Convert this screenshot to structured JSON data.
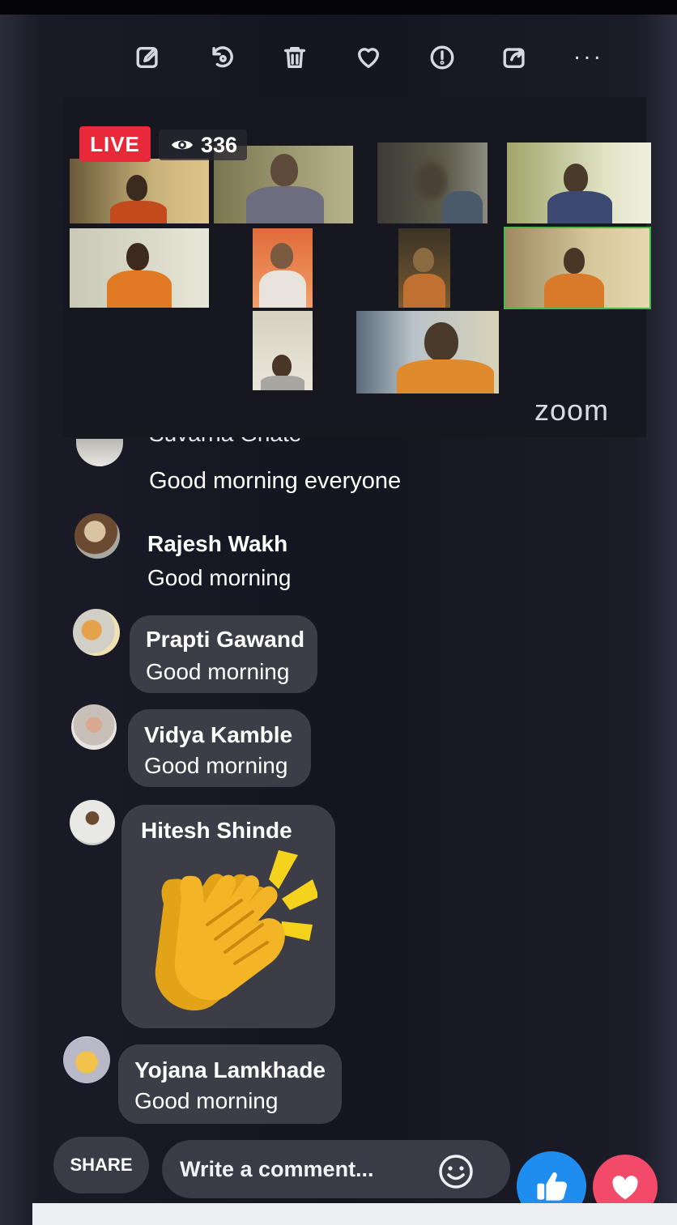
{
  "toolbar": {
    "items": [
      {
        "icon": "edit-icon"
      },
      {
        "icon": "rotate-icon"
      },
      {
        "icon": "trash-icon"
      },
      {
        "icon": "heart-icon"
      },
      {
        "icon": "info-icon"
      },
      {
        "icon": "share-icon"
      },
      {
        "icon": "more-icon",
        "label": "..."
      }
    ]
  },
  "live": {
    "badge": "LIVE",
    "viewer_count": "336",
    "brand": "zoom"
  },
  "comments": [
    {
      "name": "Suvarna Ghate",
      "text": "Good morning everyone",
      "partially_hidden": true
    },
    {
      "name": "Rajesh Wakh",
      "text": "Good morning"
    },
    {
      "name": "Prapti Gawand",
      "text": "Good morning"
    },
    {
      "name": "Vidya Kamble",
      "text": "Good morning"
    },
    {
      "name": "Hitesh Shinde",
      "sticker": "clapping-hands"
    },
    {
      "name": "Yojana Lamkhade",
      "text": "Good morning"
    }
  ],
  "composer": {
    "share_label": "SHARE",
    "placeholder": "Write a comment...",
    "like_color": "#1f8cf0",
    "love_color": "#f24a68"
  },
  "colors": {
    "live_red": "#e8293a",
    "bubble": "#3c3d46",
    "background": "#1c1d26"
  }
}
